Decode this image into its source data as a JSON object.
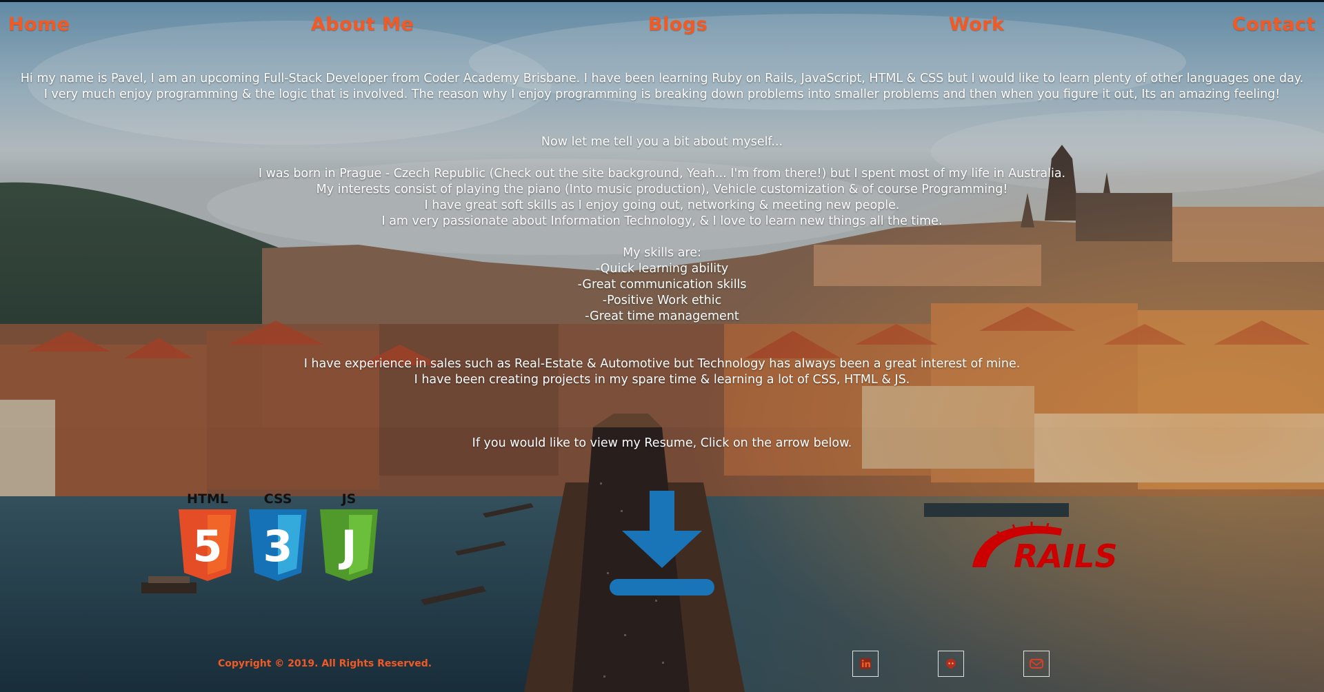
{
  "nav": {
    "home": "Home",
    "about": "About Me",
    "blogs": "Blogs",
    "work": "Work",
    "contact": "Contact"
  },
  "about": {
    "intro_1": "Hi my name is Pavel, I am an upcoming Full-Stack Developer from Coder Academy Brisbane. I have been learning Ruby on Rails, JavaScript, HTML & CSS but I would like to learn plenty of other languages one day.",
    "intro_2": "I very much enjoy programming & the logic that is involved. The reason why I enjoy programming is breaking down problems into smaller problems and then when you figure it out, Its an amazing feeling!",
    "lead": "Now let me tell you a bit about myself...",
    "bio_1": "I was born in Prague - Czech Republic (Check out the site background, Yeah... I'm from there!) but I spent most of my life in Australia.",
    "bio_2": "My interests consist of playing the piano (Into music production), Vehicle customization & of course Programming!",
    "bio_3": "I have great soft skills as I enjoy going out, networking & meeting new people.",
    "bio_4": "I am very passionate about Information Technology, & I love to learn new things all the time.",
    "skills_title": "My skills are:",
    "skills": [
      "-Quick learning ability",
      "-Great communication skills",
      "-Positive Work ethic",
      "-Great time management"
    ],
    "experience_1": "I have experience in sales such as Real-Estate & Automotive but Technology has always been a great interest of mine.",
    "experience_2": "I have been creating projects in my spare time & learning a lot of CSS, HTML & JS.",
    "resume_prompt": "If you would like to view my Resume, Click on the arrow below."
  },
  "logos": {
    "html_label": "HTML",
    "html_number": "5",
    "css_label": "CSS",
    "css_number": "3",
    "js_label": "JS",
    "js_letter": "J",
    "rails_text": "RAILS"
  },
  "footer": {
    "copyright": "Copyright © 2019. All Rights Reserved."
  },
  "social_icons": [
    "linkedin-icon",
    "github-icon",
    "email-icon"
  ],
  "colors": {
    "accent": "#f15a24",
    "download_blue": "#1a75b8",
    "html_orange": "#e44d26",
    "css_blue": "#1572b6",
    "js_green": "#5fb234",
    "rails_red": "#cc0000"
  }
}
